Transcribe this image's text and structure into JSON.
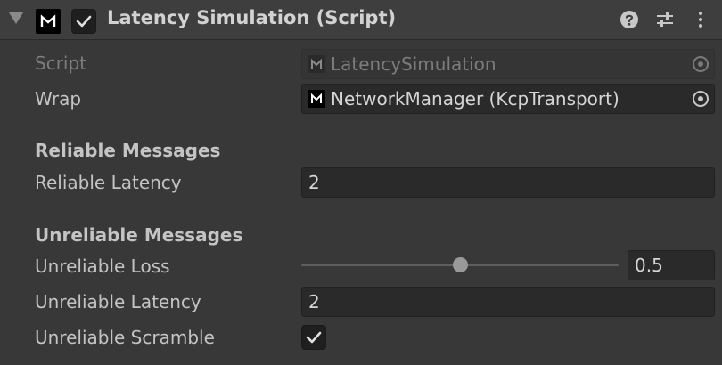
{
  "header": {
    "title": "Latency Simulation (Script)",
    "enabled": true
  },
  "fields": {
    "script": {
      "label": "Script",
      "value": "LatencySimulation"
    },
    "wrap": {
      "label": "Wrap",
      "value": "NetworkManager (KcpTransport)"
    }
  },
  "reliable": {
    "title": "Reliable Messages",
    "latency_label": "Reliable Latency",
    "latency_value": "2"
  },
  "unreliable": {
    "title": "Unreliable Messages",
    "loss_label": "Unreliable Loss",
    "loss_value": "0.5",
    "loss_fraction": 0.5,
    "latency_label": "Unreliable Latency",
    "latency_value": "2",
    "scramble_label": "Unreliable Scramble",
    "scramble_checked": true
  },
  "icons": {
    "foldout": "chevron-down-icon",
    "script_icon": "mirror-script-icon",
    "help": "help-icon",
    "presets": "sliders-icon",
    "menu": "more-vertical-icon",
    "picker": "object-picker-icon"
  },
  "colors": {
    "background": "#383838",
    "header_background": "#3e3e3e",
    "field_background": "#2a2a2a"
  }
}
